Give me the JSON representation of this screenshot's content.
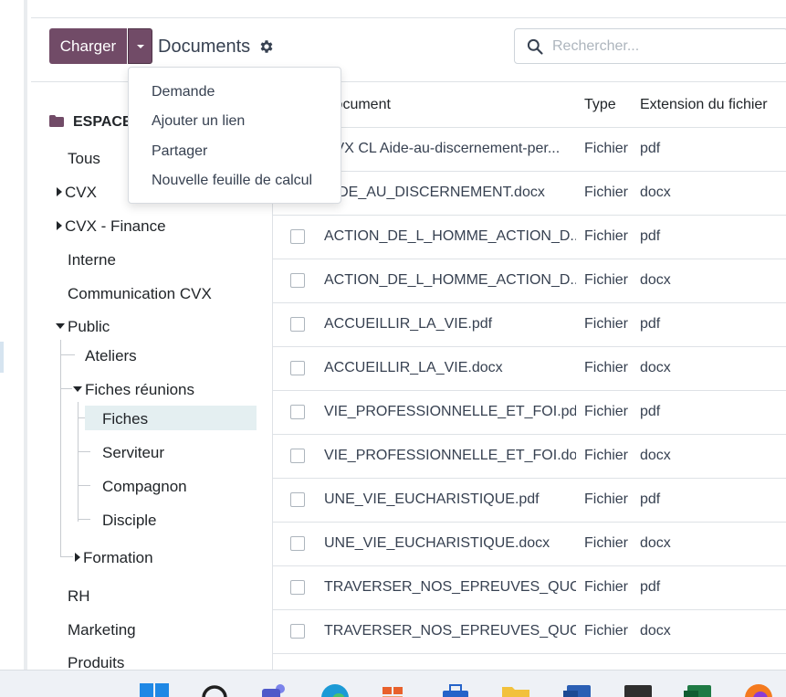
{
  "control_panel": {
    "upload_label": "Charger",
    "breadcrumb": "Documents",
    "search_placeholder": "Rechercher..."
  },
  "upload_menu": {
    "items": [
      "Demande",
      "Ajouter un lien",
      "Partager",
      "Nouvelle feuille de calcul"
    ]
  },
  "sidebar": {
    "root": "ESPACE",
    "items": {
      "tous": "Tous",
      "cvx": "CVX",
      "cvx_finance": "CVX - Finance",
      "interne": "Interne",
      "communication": "Communication CVX",
      "public": "Public",
      "ateliers": "Ateliers",
      "fiches_reunions": "Fiches réunions",
      "fiches": "Fiches",
      "serviteur": "Serviteur",
      "compagnon": "Compagnon",
      "disciple": "Disciple",
      "formation": "Formation",
      "rh": "RH",
      "marketing": "Marketing",
      "produits": "Produits"
    }
  },
  "table": {
    "headers": {
      "document": "Document",
      "type": "Type",
      "extension": "Extension du fichier"
    },
    "rows": [
      {
        "name": "CVX CL Aide-au-discernement-per...",
        "type": "Fichier",
        "ext": "pdf"
      },
      {
        "name": "AIDE_AU_DISCERNEMENT.docx",
        "type": "Fichier",
        "ext": "docx"
      },
      {
        "name": "ACTION_DE_L_HOMME_ACTION_D...",
        "type": "Fichier",
        "ext": "pdf"
      },
      {
        "name": "ACTION_DE_L_HOMME_ACTION_D...",
        "type": "Fichier",
        "ext": "docx"
      },
      {
        "name": "ACCUEILLIR_LA_VIE.pdf",
        "type": "Fichier",
        "ext": "pdf"
      },
      {
        "name": "ACCUEILLIR_LA_VIE.docx",
        "type": "Fichier",
        "ext": "docx"
      },
      {
        "name": "VIE_PROFESSIONNELLE_ET_FOI.pdf",
        "type": "Fichier",
        "ext": "pdf"
      },
      {
        "name": "VIE_PROFESSIONNELLE_ET_FOI.docx",
        "type": "Fichier",
        "ext": "docx"
      },
      {
        "name": "UNE_VIE_EUCHARISTIQUE.pdf",
        "type": "Fichier",
        "ext": "pdf"
      },
      {
        "name": "UNE_VIE_EUCHARISTIQUE.docx",
        "type": "Fichier",
        "ext": "docx"
      },
      {
        "name": "TRAVERSER_NOS_EPREUVES_QUO...",
        "type": "Fichier",
        "ext": "pdf"
      },
      {
        "name": "TRAVERSER_NOS_EPREUVES_QUO...",
        "type": "Fichier",
        "ext": "docx"
      }
    ]
  },
  "taskbar": {
    "icons": [
      "windows-start-icon",
      "search-icon",
      "teams-icon",
      "edge-icon",
      "app-icon",
      "store-icon",
      "file-explorer-icon",
      "word-icon",
      "terminal-icon",
      "excel-icon",
      "firefox-icon"
    ]
  },
  "colors": {
    "primary": "#714b67",
    "selected": "#e4eff1"
  }
}
